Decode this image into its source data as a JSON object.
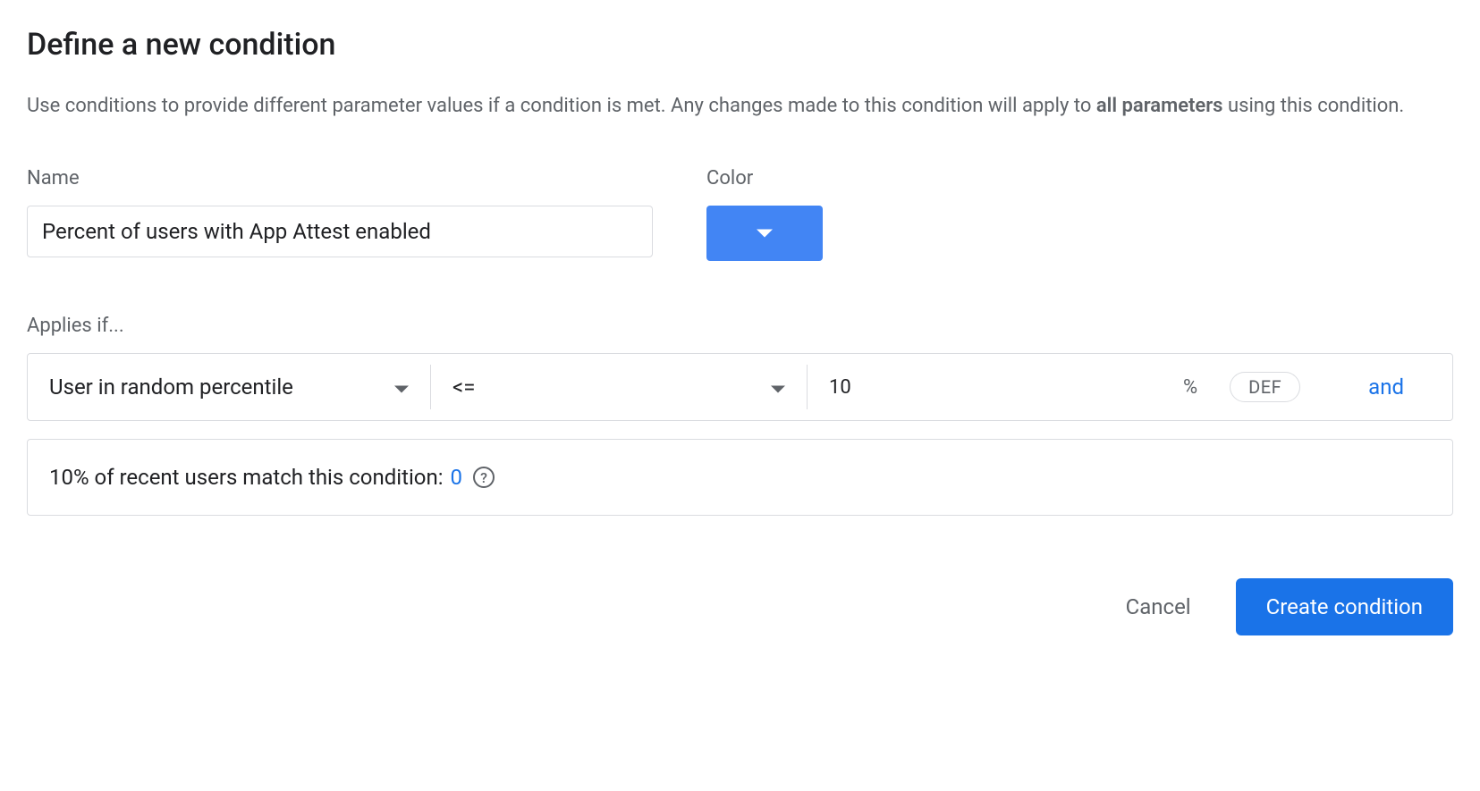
{
  "title": "Define a new condition",
  "description": {
    "prefix": "Use conditions to provide different parameter values if a condition is met. Any changes made to this condition will apply to ",
    "bold": "all parameters",
    "suffix": " using this condition."
  },
  "form": {
    "nameLabel": "Name",
    "nameValue": "Percent of users with App Attest enabled",
    "colorLabel": "Color",
    "colorValue": "#4285f4"
  },
  "condition": {
    "label": "Applies if...",
    "type": "User in random percentile",
    "operator": "<=",
    "value": "10",
    "unit": "%",
    "seed": "DEF",
    "andLabel": "and"
  },
  "match": {
    "prefix": "10% of recent users match this condition: ",
    "count": "0"
  },
  "actions": {
    "cancel": "Cancel",
    "create": "Create condition"
  }
}
